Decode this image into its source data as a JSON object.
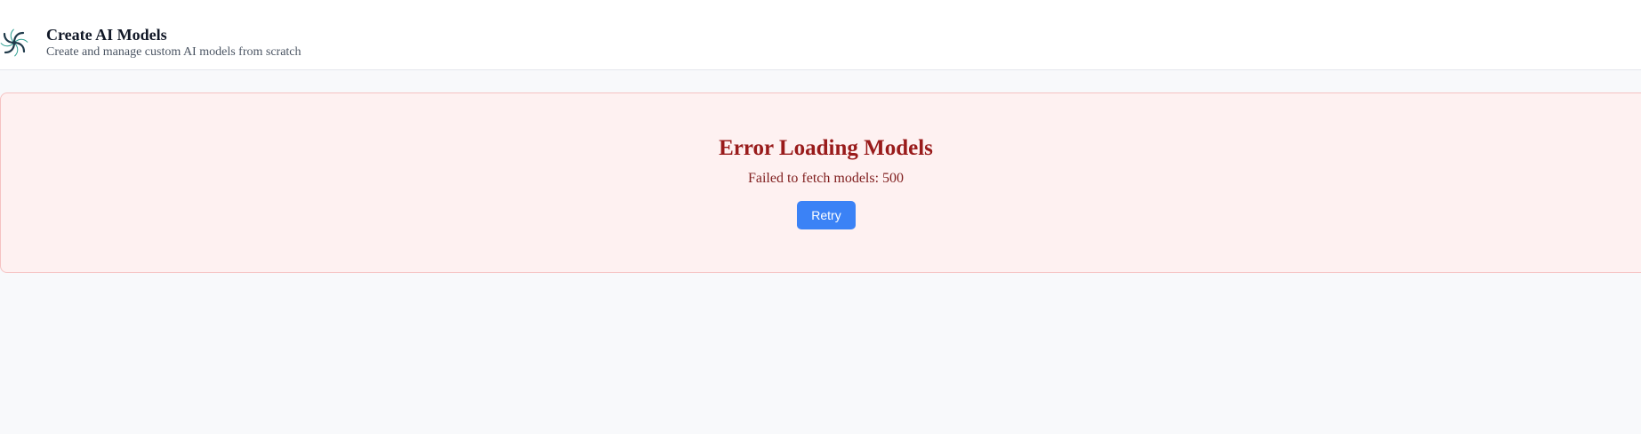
{
  "header": {
    "logo_icon": "pinwheel-logo-icon",
    "title": "Create AI Models",
    "subtitle": "Create and manage custom AI models from scratch"
  },
  "error": {
    "title": "Error Loading Models",
    "message": "Failed to fetch models: 500",
    "retry_label": "Retry"
  },
  "colors": {
    "error_background": "#fef1f1",
    "error_border": "#f5c2c2",
    "error_title": "#991b1b",
    "error_text": "#7f1d1d",
    "primary_button": "#3b82f6",
    "page_background": "#f8f9fb"
  }
}
